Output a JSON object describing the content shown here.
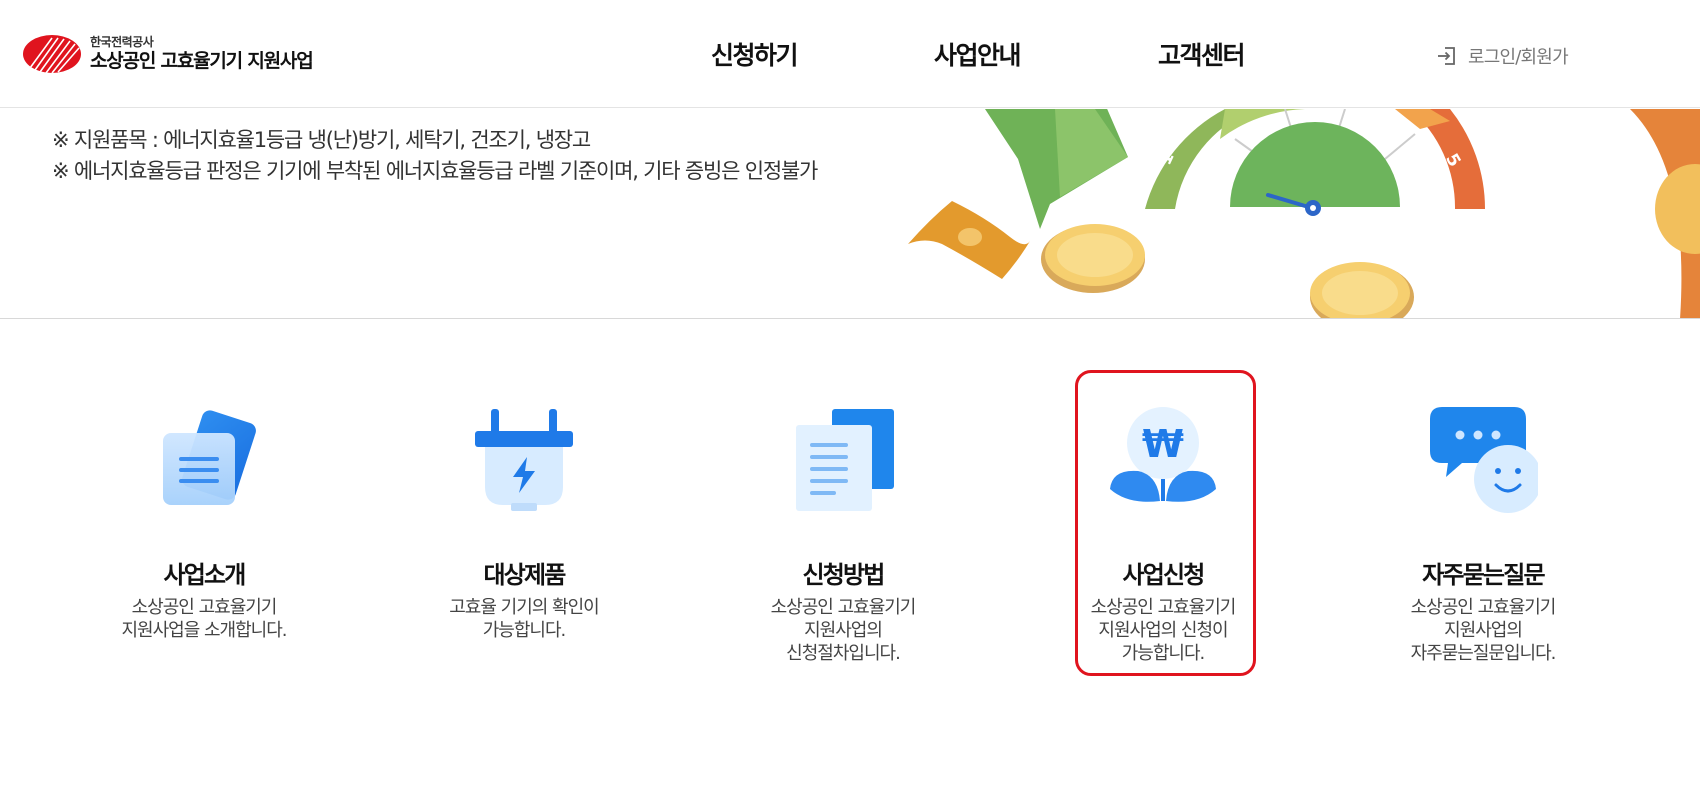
{
  "header": {
    "logo": {
      "org": "한국전력공사",
      "title": "소상공인 고효율기기 지원사업",
      "brand_color": "#e0141e"
    },
    "nav": [
      {
        "label": "신청하기"
      },
      {
        "label": "사업안내"
      },
      {
        "label": "고객센터"
      }
    ],
    "login_label": "로그인/회원가"
  },
  "banner": {
    "notice_1": "※ 지원품목 : 에너지효율1등급 냉(난)방기, 세탁기, 건조기, 냉장고",
    "notice_2": "※ 에너지효율등급 판정은 기기에 부착된 에너지효율등급 라벨 기준이며, 기타 증빙은 인정불가",
    "gauge_labels": [
      "1",
      "5"
    ]
  },
  "services": [
    {
      "icon": "documents-icon",
      "title": "사업소개",
      "desc": "소상공인 고효율기기\n지원사업을 소개합니다."
    },
    {
      "icon": "plug-icon",
      "title": "대상제품",
      "desc": "고효율 기기의 확인이\n가능합니다."
    },
    {
      "icon": "paper-list-icon",
      "title": "신청방법",
      "desc": "소상공인 고효율기기\n지원사업의\n신청절차입니다."
    },
    {
      "icon": "won-sprout-icon",
      "title": "사업신청",
      "desc": "소상공인 고효율기기\n지원사업의 신청이\n가능합니다."
    },
    {
      "icon": "chat-bubble-icon",
      "title": "자주묻는질문",
      "desc": "소상공인 고효율기기\n지원사업의\n자주묻는질문입니다."
    }
  ],
  "highlight_color": "#e0141e"
}
